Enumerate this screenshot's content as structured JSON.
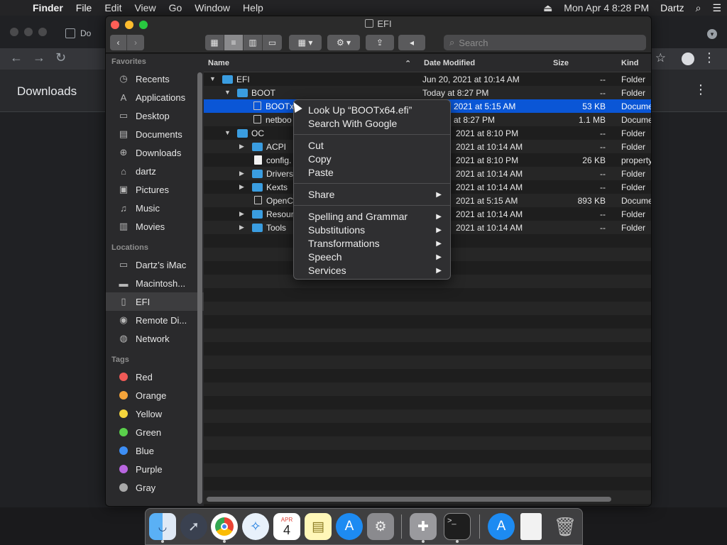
{
  "menubar": {
    "app": "Finder",
    "items": [
      "File",
      "Edit",
      "View",
      "Go",
      "Window",
      "Help"
    ],
    "clock": "Mon Apr 4  8:28 PM",
    "user": "Dartz"
  },
  "chrome": {
    "tab_title": "Do",
    "downloads_title": "Downloads"
  },
  "finder": {
    "window_title": "EFI",
    "search_placeholder": "Search",
    "sidebar": {
      "favorites_label": "Favorites",
      "favorites": [
        "Recents",
        "Applications",
        "Desktop",
        "Documents",
        "Downloads",
        "dartz",
        "Pictures",
        "Music",
        "Movies"
      ],
      "locations_label": "Locations",
      "locations": [
        "Dartz’s iMac",
        "Macintosh...",
        "EFI",
        "Remote Di...",
        "Network"
      ],
      "tags_label": "Tags",
      "tags": [
        {
          "name": "Red",
          "color": "#f05a57"
        },
        {
          "name": "Orange",
          "color": "#f5a43a"
        },
        {
          "name": "Yellow",
          "color": "#f5d63d"
        },
        {
          "name": "Green",
          "color": "#5ad04b"
        },
        {
          "name": "Blue",
          "color": "#3d8ef5"
        },
        {
          "name": "Purple",
          "color": "#b966e0"
        },
        {
          "name": "Gray",
          "color": "#a8a8a8"
        }
      ]
    },
    "columns": {
      "name": "Name",
      "date": "Date Modified",
      "size": "Size",
      "kind": "Kind"
    },
    "rows": [
      {
        "name": "EFI",
        "date": "Jun 20, 2021 at 10:14 AM",
        "size": "--",
        "kind": "Folder"
      },
      {
        "name": "BOOT",
        "date": "Today at 8:27 PM",
        "size": "--",
        "kind": "Folder"
      },
      {
        "name": "BOOTx",
        "date": "2021 at 5:15 AM",
        "size": "53 KB",
        "kind": "Docume"
      },
      {
        "name": "netboo",
        "date": "at 8:27 PM",
        "size": "1.1 MB",
        "kind": "Docume"
      },
      {
        "name": "OC",
        "date": "2021 at 8:10 PM",
        "size": "--",
        "kind": "Folder"
      },
      {
        "name": "ACPI",
        "date": "2021 at 10:14 AM",
        "size": "--",
        "kind": "Folder"
      },
      {
        "name": "config.",
        "date": "2021 at 8:10 PM",
        "size": "26 KB",
        "kind": "property"
      },
      {
        "name": "Drivers",
        "date": "2021 at 10:14 AM",
        "size": "--",
        "kind": "Folder"
      },
      {
        "name": "Kexts",
        "date": "2021 at 10:14 AM",
        "size": "--",
        "kind": "Folder"
      },
      {
        "name": "OpenC",
        "date": "2021 at 5:15 AM",
        "size": "893 KB",
        "kind": "Docume"
      },
      {
        "name": "Resour",
        "date": "2021 at 10:14 AM",
        "size": "--",
        "kind": "Folder"
      },
      {
        "name": "Tools",
        "date": "2021 at 10:14 AM",
        "size": "--",
        "kind": "Folder"
      }
    ]
  },
  "context_menu": {
    "look_up": "Look Up “BOOTx64.efi”",
    "search_google": "Search With Google",
    "cut": "Cut",
    "copy": "Copy",
    "paste": "Paste",
    "share": "Share",
    "spelling": "Spelling and Grammar",
    "substitutions": "Substitutions",
    "transformations": "Transformations",
    "speech": "Speech",
    "services": "Services"
  },
  "dock": {
    "calendar_month": "APR",
    "calendar_day": "4"
  },
  "colors": {
    "selection": "#0a56d6",
    "folder": "#3a9de0",
    "close": "#fe5f57",
    "minimize": "#febc2e",
    "zoom": "#28c840"
  }
}
